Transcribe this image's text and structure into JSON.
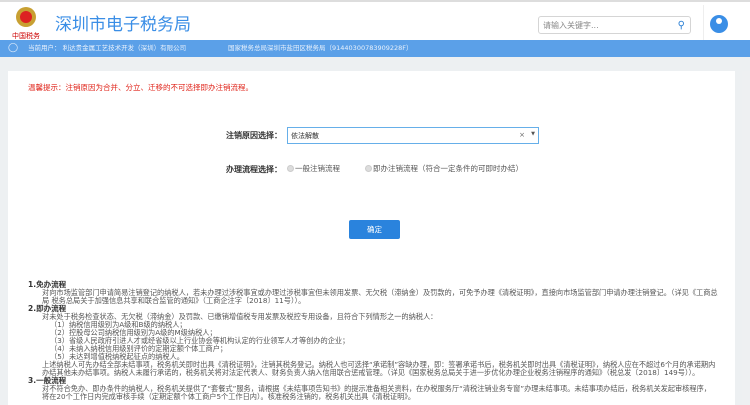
{
  "header": {
    "site_title": "深圳市电子税务局",
    "logo_text": "中国税务",
    "search_placeholder": "请输入关键字..."
  },
  "userbar": {
    "current_user": "当前用户： 利达贵金属工艺技术开发（深圳）有限公司",
    "tax_office": "国家税务总局深圳市盐田区税务局（91440300783909228F）"
  },
  "main": {
    "warning": "温馨提示：注销原因为合并、分立、迁移的不可选择即办注销流程。",
    "reason_label": "注销原因选择：",
    "reason_value": "依法解散",
    "process_label": "办理流程选择：",
    "process_options": [
      "一般注销流程",
      "即办注销流程（符合一定条件的可即时办结）"
    ],
    "confirm": "确定"
  },
  "notes": [
    {
      "title": "1.免办流程",
      "lines": [
        "对向市场监管部门申请简易注销登记的纳税人，若未办理过涉税事宜或办理过涉税事宜但未领用发票、无欠税（滞纳金）及罚款的，可免予办理《清税证明》，直接向市场监管部门申请办理注销登记。（详见《工商总局 税务总局关于加强信息共享和联合监管的通知》（工商企注字〔2018〕11号））。"
      ]
    },
    {
      "title": "2.即办流程",
      "lines": [
        "对未处于税务检查状态、无欠税（滞纳金）及罚款、已缴销增值税专用发票及税控专用设备，且符合下列情形之一的纳税人：",
        "（1）纳税信用级别为A级和B级的纳税人；",
        "（2）控股母公司纳税信用级别为A级的M级纳税人；",
        "（3）省级人民政府引进人才或经省级以上行业协会等机构认定的行业领军人才等创办的企业；",
        "（4）未纳入纳税信用级别评价的定期定额个体工商户；",
        "（5）未达到增值税纳税起征点的纳税人。",
        "上述纳税人可先办结全部未结事项，税务机关即时出具《清税证明》，注销其税务登记。纳税人也可选择“承诺制”容缺办理，即：签署承诺书后，税务机关即时出具《清税证明》，纳税人应在不超过6个月的承诺期内办结其他未办结事项。纳税人未履行承诺的，税务机关将对法定代表人、财务负责人纳入信用联合惩戒管理。（详见《国家税务总局关于进一步优化办理企业税务注销程序的通知》（税总发〔2018〕149号））。"
      ]
    },
    {
      "title": "3.一般流程",
      "lines": [
        "对不符合免办、即办条件的纳税人，税务机关提供了“套餐式”服务，请根据《未结事项告知书》的提示准备相关资料，在办税服务厅“清税注销业务专窗”办理未结事项。未结事项办结后，税务机关发起审核程序，将在20个工作日内完成审核手续（定期定额个体工商户5个工作日内）。核准税务注销的，税务机关出具《清税证明》。"
      ]
    }
  ]
}
